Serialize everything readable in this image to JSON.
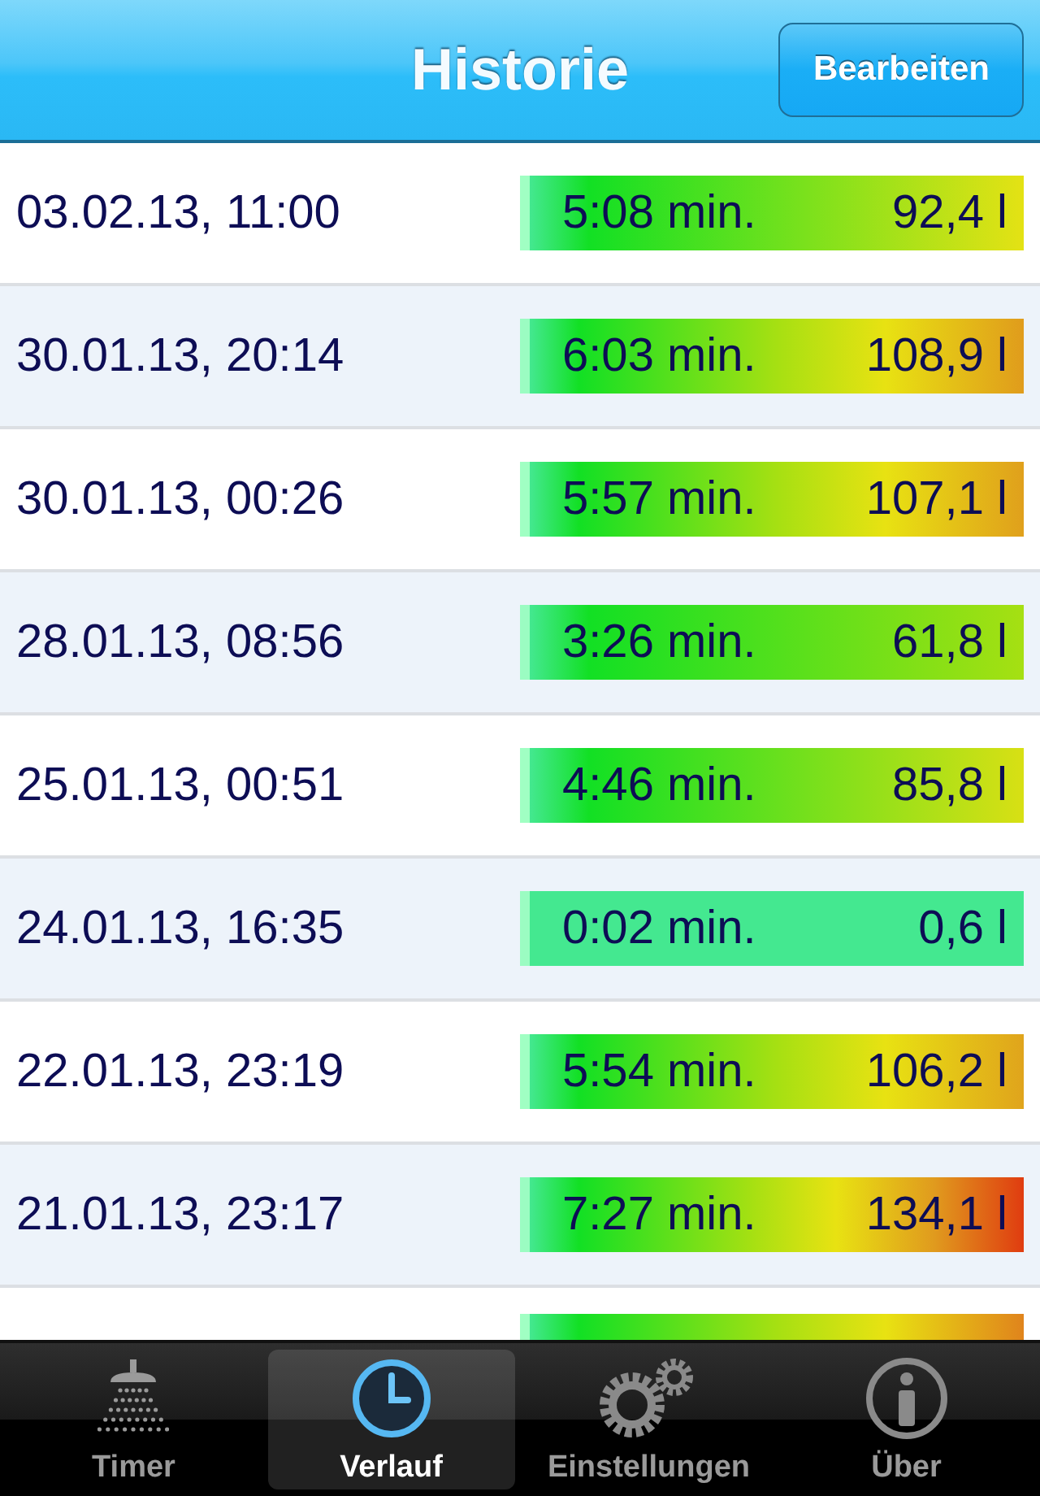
{
  "nav_bar": {
    "title": "Historie",
    "edit_button": "Bearbeiten"
  },
  "history": [
    {
      "date": "03.02.13, 11:00",
      "duration": "5:08 min.",
      "volume": "92,4 l",
      "color": "#e4e214"
    },
    {
      "date": "30.01.13, 20:14",
      "duration": "6:03 min.",
      "volume": "108,9 l",
      "color": "#e09c1c"
    },
    {
      "date": "30.01.13, 00:26",
      "duration": "5:57 min.",
      "volume": "107,1 l",
      "color": "#e0a01c"
    },
    {
      "date": "28.01.13, 08:56",
      "duration": "3:26 min.",
      "volume": "61,8 l",
      "color": "#a6e012"
    },
    {
      "date": "25.01.13, 00:51",
      "duration": "4:46 min.",
      "volume": "85,8 l",
      "color": "#d8e014"
    },
    {
      "date": "24.01.13, 16:35",
      "duration": "0:02 min.",
      "volume": "0,6 l",
      "color": "#44e890"
    },
    {
      "date": "22.01.13, 23:19",
      "duration": "5:54 min.",
      "volume": "106,2 l",
      "color": "#e0a41c"
    },
    {
      "date": "21.01.13, 23:17",
      "duration": "7:27 min.",
      "volume": "134,1 l",
      "color": "#e03c10"
    },
    {
      "color": "#e0841c"
    }
  ],
  "tab_bar": [
    {
      "kind": "shower",
      "label": "Timer",
      "selected": false
    },
    {
      "kind": "clock",
      "label": "Verlauf",
      "selected": true
    },
    {
      "kind": "gears",
      "label": "Einstellungen",
      "selected": false
    },
    {
      "kind": "info",
      "label": "Über",
      "selected": false
    }
  ]
}
